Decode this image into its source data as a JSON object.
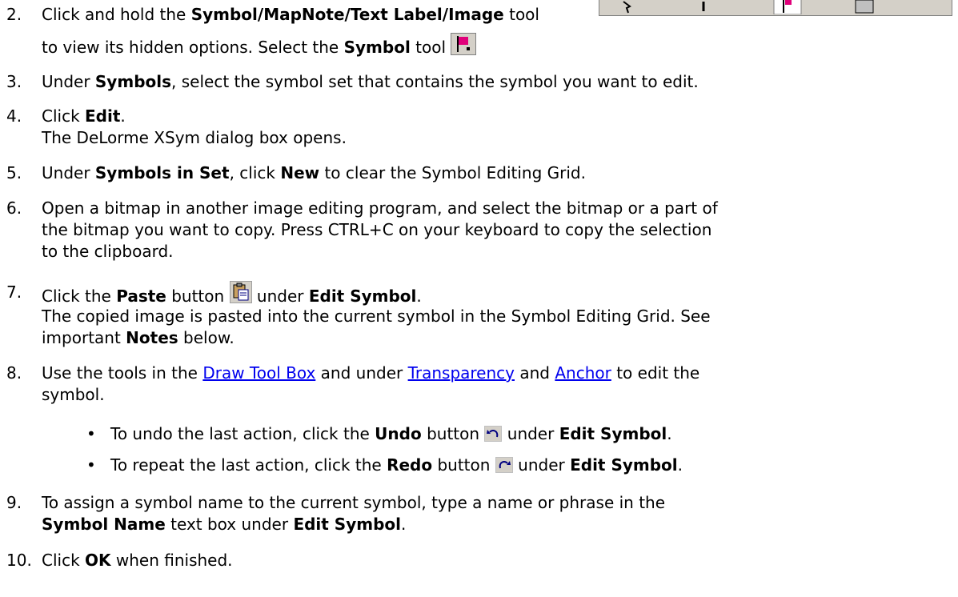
{
  "steps": [
    {
      "num": "2.",
      "a": "Click and hold the ",
      "b": "Symbol/MapNote/Text Label/Image",
      "c": " tool",
      "line2a": "to view its hidden options. Select the ",
      "line2b": "Symbol",
      "line2c": " tool"
    },
    {
      "num": "3.",
      "a": "Under ",
      "b": "Symbols",
      "c": ", select the symbol set that contains the symbol you want to edit."
    },
    {
      "num": "4.",
      "a": "Click ",
      "b": "Edit",
      "c": ".",
      "line2": "The DeLorme XSym dialog box opens."
    },
    {
      "num": "5.",
      "a": "Under ",
      "b": "Symbols in Set",
      "c": ", click ",
      "d": "New",
      "e": " to clear the Symbol Editing Grid."
    },
    {
      "num": "6.",
      "l1": "Open a bitmap in another image editing program, and select the bitmap or a part of",
      "l2": "the bitmap you want to copy. Press CTRL+C on your keyboard to copy the selection",
      "l3": "to the clipboard."
    },
    {
      "num": "7.",
      "a": "Click the ",
      "b": "Paste",
      "c": " button ",
      "d": " under ",
      "e": "Edit Symbol",
      "f": ".",
      "l2": "The copied image is pasted into the current symbol in the Symbol Editing Grid. See",
      "l3a": "important ",
      "l3b": "Notes",
      "l3c": " below."
    },
    {
      "num": "8.",
      "a": "Use the tools in the ",
      "link1": "Draw Tool Box",
      "b": " and under ",
      "link2": "Transparency",
      "c": " and ",
      "link3": "Anchor",
      "d": " to edit the",
      "l2": "symbol."
    },
    {
      "num": "9.",
      "l1": "To assign a symbol name to the current symbol, type a name or phrase in the",
      "l2b": "Symbol Name",
      "l2c": " text box under ",
      "l2d": "Edit Symbol",
      "l2e": "."
    },
    {
      "num": "10.",
      "a": "Click ",
      "b": "OK",
      "c": " when finished."
    }
  ],
  "bullets": [
    {
      "dot": "•",
      "a": "To undo the last action, click the ",
      "b": "Undo",
      "c": " button ",
      "d": " under ",
      "e": "Edit Symbol",
      "f": "."
    },
    {
      "dot": "•",
      "a": "To repeat the last action, click the ",
      "b": "Redo",
      "c": " button ",
      "d": " under ",
      "e": "Edit Symbol",
      "f": "."
    }
  ],
  "colors": {
    "link": "#0000ee",
    "text": "#000000",
    "toolbar": "#d4d0c8"
  },
  "icons": [
    "symbol-toolbar-strip",
    "symbol-flag-icon",
    "paste-icon",
    "undo-icon",
    "redo-icon"
  ]
}
